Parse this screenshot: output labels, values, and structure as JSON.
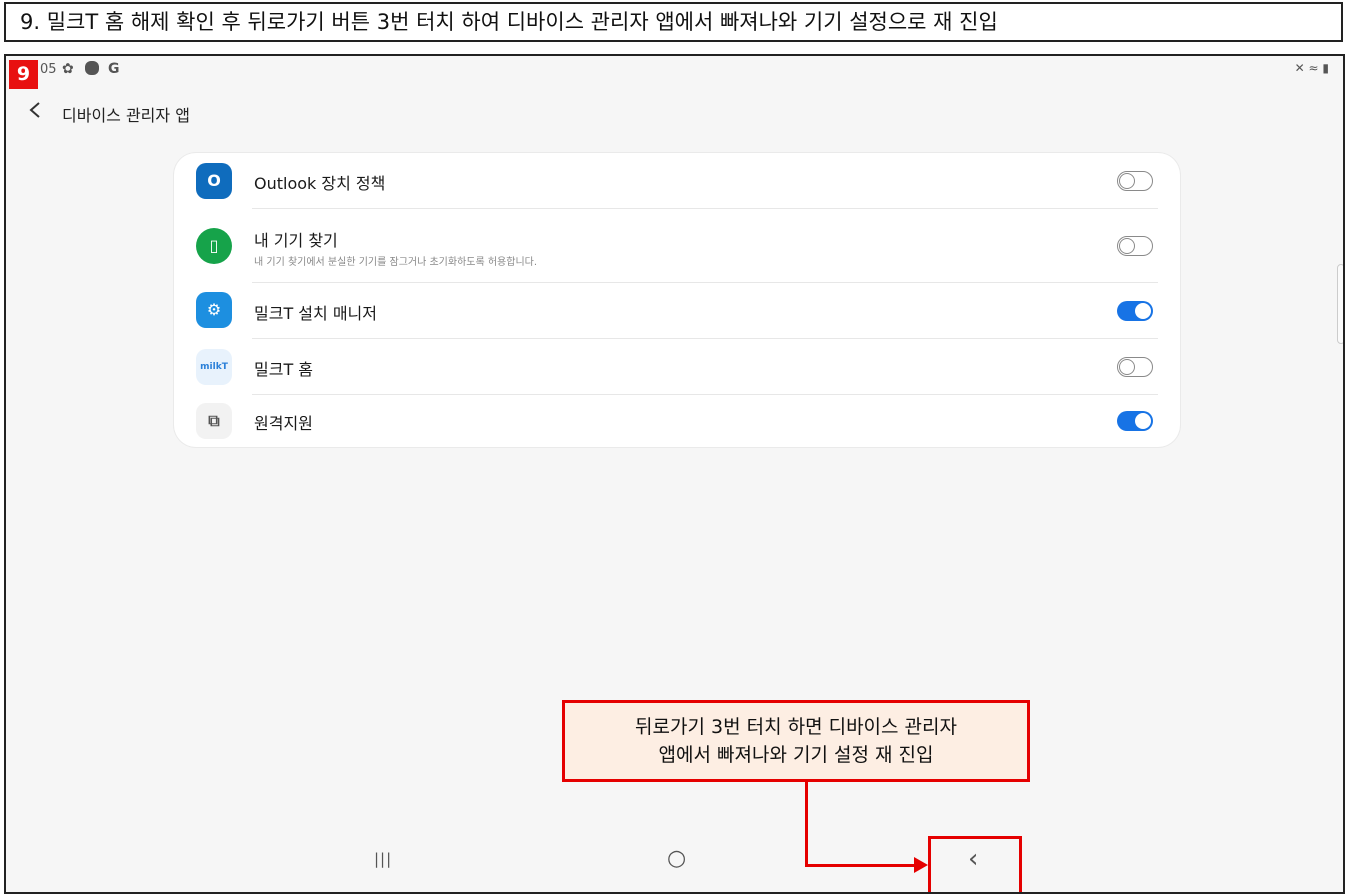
{
  "instruction": "9. 밀크T 홈 해제 확인 후 뒤로가기 버튼 3번 터치 하여 디바이스 관리자 앱에서 빠져나와 기기 설정으로 재 진입",
  "step_badge": "9",
  "status_bar": {
    "time": "05",
    "left_icons": [
      "gear-icon",
      "circle-icon",
      "google-icon"
    ],
    "google_letter": "G",
    "right_icons": [
      "mute-icon",
      "wifi-icon",
      "battery-icon"
    ]
  },
  "header": {
    "title": "디바이스 관리자 앱"
  },
  "apps": [
    {
      "name": "Outlook 장치 정책",
      "subtitle": "",
      "enabled": false,
      "icon": "outlook-icon",
      "icon_text": "O",
      "color": "#0f6cbd"
    },
    {
      "name": "내 기기 찾기",
      "subtitle": "내 기기 찾기에서 분실한 기기를 잠그거나 초기화하도록 허용합니다.",
      "enabled": false,
      "icon": "find-my-device-icon",
      "icon_text": "▯",
      "color": "#16a34a"
    },
    {
      "name": "밀크T 설치 매니저",
      "subtitle": "",
      "enabled": true,
      "icon": "milkt-install-manager-icon",
      "icon_text": "⚙",
      "color": "#1d8fe0"
    },
    {
      "name": "밀크T 홈",
      "subtitle": "",
      "enabled": false,
      "icon": "milkt-home-icon",
      "icon_text": "milkT",
      "color": "#2b80d8"
    },
    {
      "name": "원격지원",
      "subtitle": "",
      "enabled": true,
      "icon": "remote-support-icon",
      "icon_text": "⧉",
      "color": "#555555"
    }
  ],
  "callout": {
    "line1": "뒤로가기 3번 터치 하면 디바이스 관리자",
    "line2": "앱에서 빠져나와 기기 설정 재 진입"
  },
  "navbar": {
    "recent": "|||",
    "home": "○",
    "back": "‹"
  },
  "colors": {
    "accent": "#1773e5",
    "highlight": "#e50000",
    "callout_bg": "#fdeee3"
  }
}
